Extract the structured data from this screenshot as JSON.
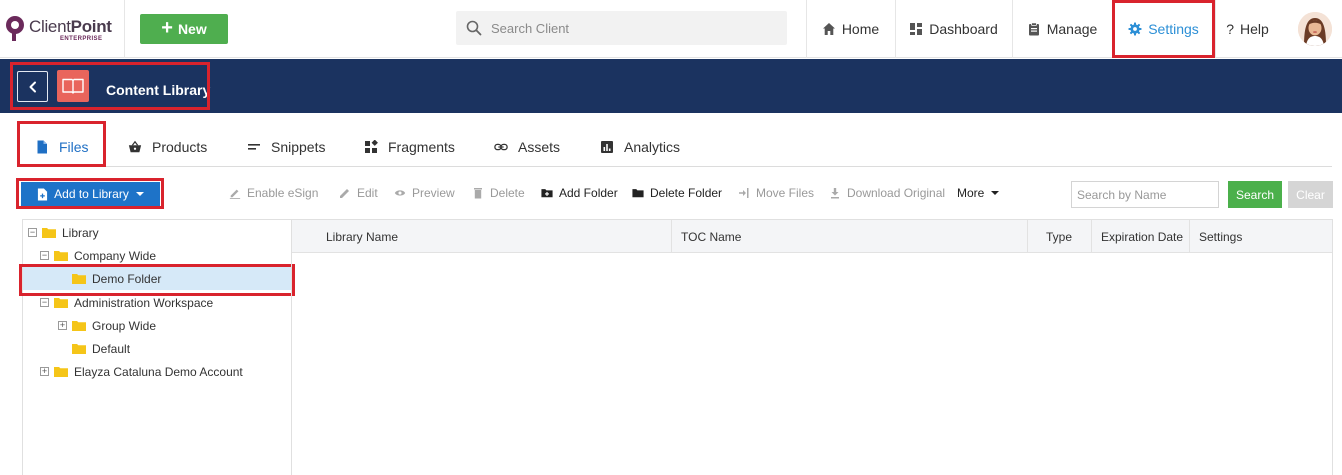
{
  "brand": {
    "name_light": "Client",
    "name_bold": "Point",
    "sub": "ENTERPRISE",
    "accent": "#6b2a5b"
  },
  "topbar": {
    "new_label": "New",
    "search_placeholder": "Search Client",
    "nav": {
      "home": "Home",
      "dashboard": "Dashboard",
      "manage": "Manage",
      "settings": "Settings",
      "help": "Help"
    },
    "settings_color": "#2c8fd6"
  },
  "header": {
    "title": "Content Library",
    "background": "#1b3360"
  },
  "tabs": {
    "files": "Files",
    "products": "Products",
    "snippets": "Snippets",
    "fragments": "Fragments",
    "assets": "Assets",
    "analytics": "Analytics",
    "active": "Files"
  },
  "toolbar": {
    "add_to_library": "Add to Library",
    "enable_esign": "Enable eSign",
    "edit": "Edit",
    "preview": "Preview",
    "delete": "Delete",
    "add_folder": "Add Folder",
    "delete_folder": "Delete Folder",
    "move_files": "Move Files",
    "download_original": "Download Original",
    "more": "More",
    "search_placeholder": "Search by Name",
    "search_label": "Search",
    "clear_label": "Clear"
  },
  "tree": {
    "root": "Library",
    "company_wide": "Company Wide",
    "demo_folder": "Demo Folder",
    "admin_workspace": "Administration Workspace",
    "group_wide": "Group Wide",
    "default": "Default",
    "demo_account": "Elayza Cataluna Demo Account",
    "selected": "Demo Folder"
  },
  "grid": {
    "columns": {
      "library_name": "Library Name",
      "toc_name": "TOC Name",
      "type": "Type",
      "expiration_date": "Expiration Date",
      "settings": "Settings"
    }
  },
  "colors": {
    "highlight": "#d9232d",
    "primary": "#1e73c8",
    "success": "#4bb04b",
    "folder": "#f5c518"
  }
}
